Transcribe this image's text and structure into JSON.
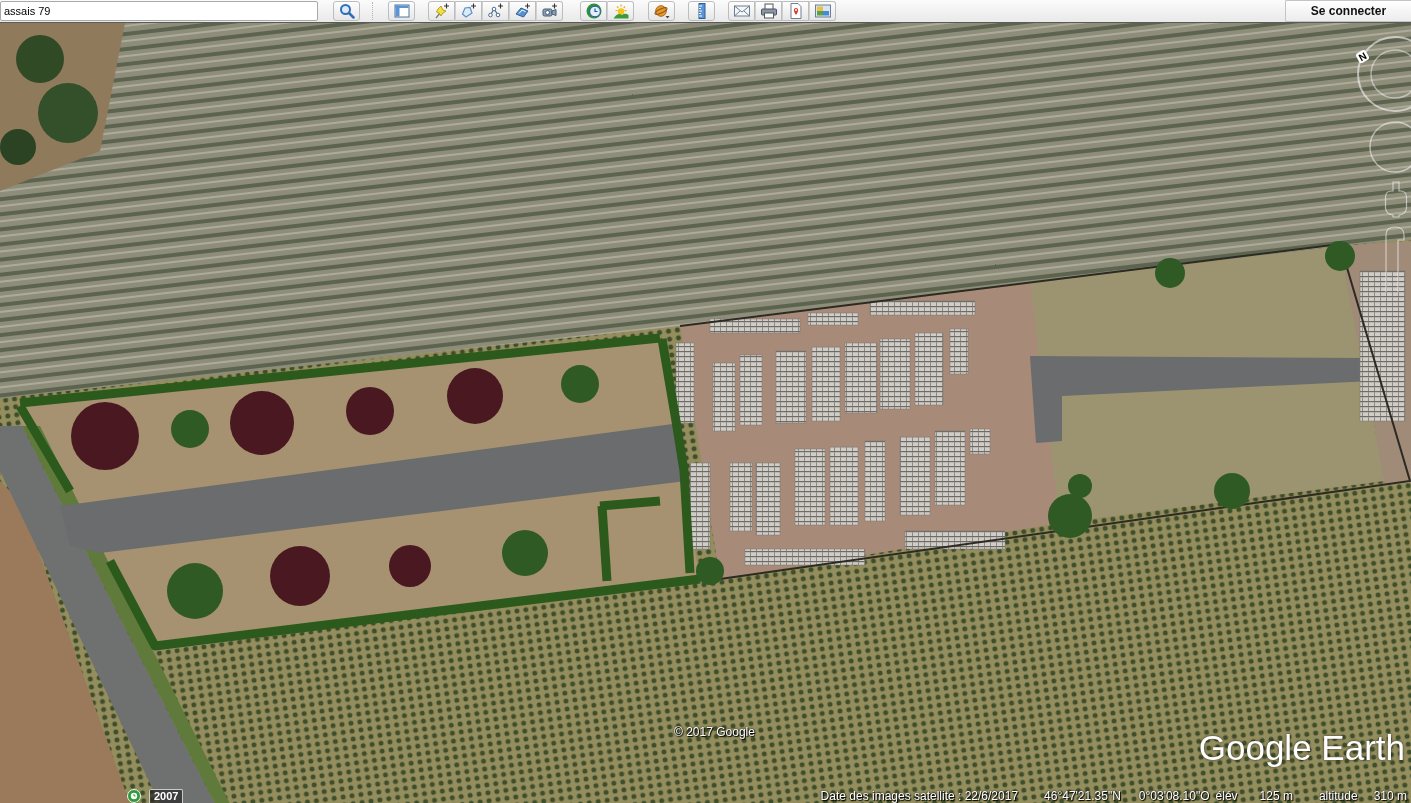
{
  "toolbar": {
    "search_field": {
      "value": "assais 79"
    },
    "sign_in_button": {
      "label": "Se connecter"
    }
  },
  "map": {
    "navigation": {
      "north_label": "N"
    },
    "copyright": "© 2017 Google",
    "logo": "Google Earth",
    "timeline": {
      "year": "2007"
    }
  },
  "status_bar": {
    "imagery_date": "Date des images satellite : 22/6/2017",
    "latitude": "46°47'21.35\"N",
    "longitude": "0°03'08.10\"O",
    "elevation": {
      "label": "élév",
      "value": "125 m"
    },
    "altitude": {
      "label": "altitude",
      "value": "310 m"
    }
  }
}
